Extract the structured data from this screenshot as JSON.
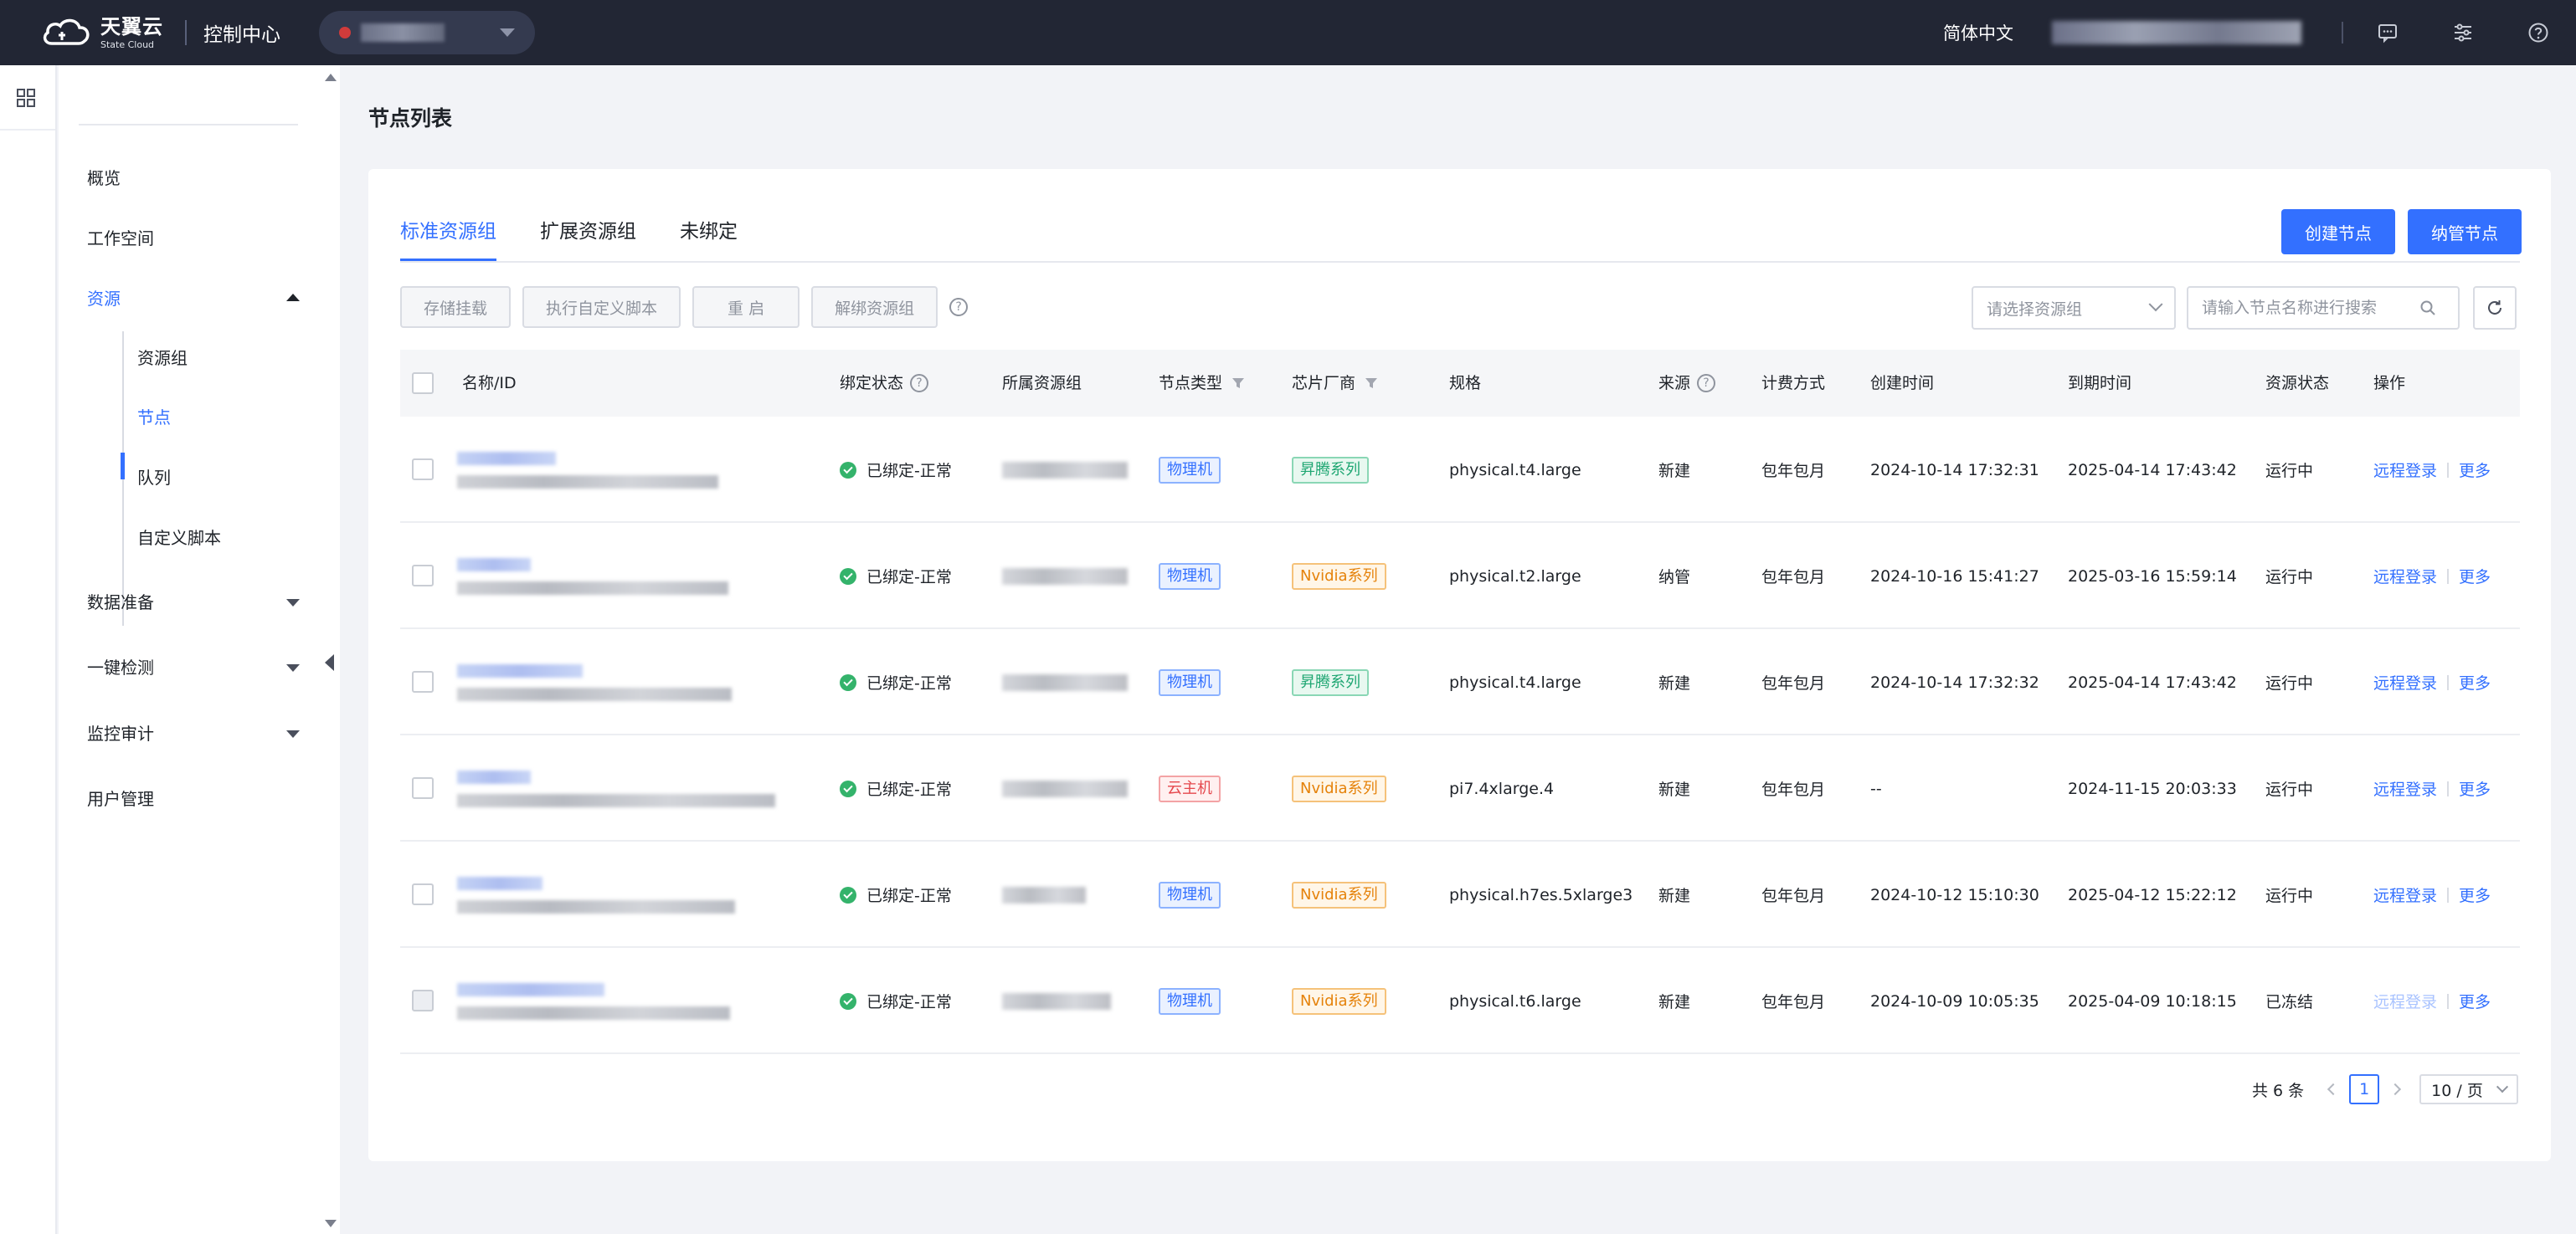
{
  "topbar": {
    "logo_cn": "天翼云",
    "logo_en": "State Cloud",
    "console_title": "控制中心",
    "language": "简体中文",
    "icons": [
      "message-icon",
      "settings-sliders-icon",
      "help-icon"
    ]
  },
  "sidebar": {
    "items": [
      {
        "label": "概览"
      },
      {
        "label": "工作空间"
      },
      {
        "label": "资源",
        "expanded": true,
        "children": [
          "资源组",
          "节点",
          "队列",
          "自定义脚本"
        ],
        "active_child": "节点"
      },
      {
        "label": "数据准备"
      },
      {
        "label": "一键检测"
      },
      {
        "label": "监控审计"
      },
      {
        "label": "用户管理"
      }
    ]
  },
  "page": {
    "title": "节点列表",
    "tabs": [
      "标准资源组",
      "扩展资源组",
      "未绑定"
    ],
    "active_tab": "标准资源组",
    "actions": {
      "create": "创建节点",
      "manage": "纳管节点"
    },
    "toolbar": [
      "存储挂载",
      "执行自定义脚本",
      "重 启",
      "解绑资源组"
    ],
    "filter_placeholder": "请选择资源组",
    "search_placeholder": "请输入节点名称进行搜索"
  },
  "table": {
    "columns": [
      "名称/ID",
      "绑定状态",
      "所属资源组",
      "节点类型",
      "芯片厂商",
      "规格",
      "来源",
      "计费方式",
      "创建时间",
      "到期时间",
      "资源状态",
      "操作"
    ],
    "rows": [
      {
        "bind": "已绑定-正常",
        "type": "物理机",
        "type_color": "blue",
        "vendor": "昇腾系列",
        "vendor_color": "green",
        "spec": "physical.t4.large",
        "source": "新建",
        "billing": "包年包月",
        "created": "2024-10-14 17:32:31",
        "expires": "2025-04-14 17:43:42",
        "state": "运行中",
        "op1": "远程登录",
        "op2": "更多",
        "op1_enabled": true
      },
      {
        "bind": "已绑定-正常",
        "type": "物理机",
        "type_color": "blue",
        "vendor": "Nvidia系列",
        "vendor_color": "orange",
        "spec": "physical.t2.large",
        "source": "纳管",
        "billing": "包年包月",
        "created": "2024-10-16 15:41:27",
        "expires": "2025-03-16 15:59:14",
        "state": "运行中",
        "op1": "远程登录",
        "op2": "更多",
        "op1_enabled": true
      },
      {
        "bind": "已绑定-正常",
        "type": "物理机",
        "type_color": "blue",
        "vendor": "昇腾系列",
        "vendor_color": "green",
        "spec": "physical.t4.large",
        "source": "新建",
        "billing": "包年包月",
        "created": "2024-10-14 17:32:32",
        "expires": "2025-04-14 17:43:42",
        "state": "运行中",
        "op1": "远程登录",
        "op2": "更多",
        "op1_enabled": true
      },
      {
        "bind": "已绑定-正常",
        "type": "云主机",
        "type_color": "red",
        "vendor": "Nvidia系列",
        "vendor_color": "orange",
        "spec": "pi7.4xlarge.4",
        "source": "新建",
        "billing": "包年包月",
        "created": "--",
        "expires": "2024-11-15 20:03:33",
        "state": "运行中",
        "op1": "远程登录",
        "op2": "更多",
        "op1_enabled": true
      },
      {
        "bind": "已绑定-正常",
        "type": "物理机",
        "type_color": "blue",
        "vendor": "Nvidia系列",
        "vendor_color": "orange",
        "spec": "physical.h7es.5xlarge3",
        "source": "新建",
        "billing": "包年包月",
        "created": "2024-10-12 15:10:30",
        "expires": "2025-04-12 15:22:12",
        "state": "运行中",
        "op1": "远程登录",
        "op2": "更多",
        "op1_enabled": true
      },
      {
        "bind": "已绑定-正常",
        "type": "物理机",
        "type_color": "blue",
        "vendor": "Nvidia系列",
        "vendor_color": "orange",
        "spec": "physical.t6.large",
        "source": "新建",
        "billing": "包年包月",
        "created": "2024-10-09 10:05:35",
        "expires": "2025-04-09 10:18:15",
        "state": "已冻结",
        "op1": "远程登录",
        "op2": "更多",
        "op1_enabled": false
      }
    ]
  },
  "pagination": {
    "total": "共 6 条",
    "current": "1",
    "page_size": "10 / 页"
  }
}
